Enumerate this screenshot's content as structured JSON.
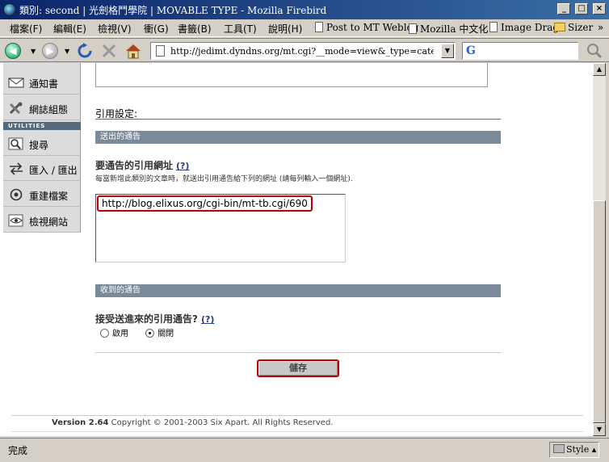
{
  "window": {
    "title": "類別: second | 光劍格鬥學院 | MOVABLE TYPE - Mozilla Firebird",
    "minimize_glyph": "_",
    "maximize_glyph": "□",
    "close_glyph": "×"
  },
  "menu": {
    "items": [
      "檔案(F)",
      "編輯(E)",
      "檢視(V)",
      "衝(G)",
      "書籤(B)",
      "工具(T)",
      "說明(H)"
    ]
  },
  "bookmarks": {
    "items": [
      "Post to MT Weblog",
      "Mozilla 中文化",
      "Image Drag",
      "Sizer"
    ],
    "overflow": "»"
  },
  "navigation": {
    "url": "http://jedimt.dyndns.org/mt.cgi?__mode=view&_type=category&blog_",
    "search_value": ""
  },
  "sidebar": {
    "utilities_heading": "UTILITIES",
    "items": [
      {
        "label": "通知書",
        "icon": "envelope-icon"
      },
      {
        "label": "網誌組態",
        "icon": "tools-icon"
      },
      {
        "label": "搜尋",
        "icon": "magnifier-icon"
      },
      {
        "label": "匯入 / 匯出",
        "icon": "import-export-icon"
      },
      {
        "label": "重建檔案",
        "icon": "rebuild-icon"
      },
      {
        "label": "檢視網站",
        "icon": "eye-icon"
      }
    ]
  },
  "form": {
    "section_title": "引用設定:",
    "outgoing_bar": "送出的通告",
    "ping_label": "要通告的引用網址",
    "help_text": "(?)",
    "ping_hint": "每當新增此類別的文章時，就送出引用通告給下列的網址 (請每列輸入一個網址).",
    "ping_urls": "http://blog.elixus.org/cgi-bin/mt-tb.cgi/690",
    "incoming_bar": "收到的通告",
    "accept_label": "接受送進來的引用通告?",
    "accept_help": "(?)",
    "radio_on_label": "啟用",
    "radio_off_label": "關閉",
    "selected": "off",
    "save_label": "儲存"
  },
  "footer": {
    "version": "Version 2.64",
    "copyright": "Copyright © 2001-2003 Six Apart. All Rights Reserved."
  },
  "status": {
    "text": "完成",
    "style_label": "Style ▴"
  }
}
